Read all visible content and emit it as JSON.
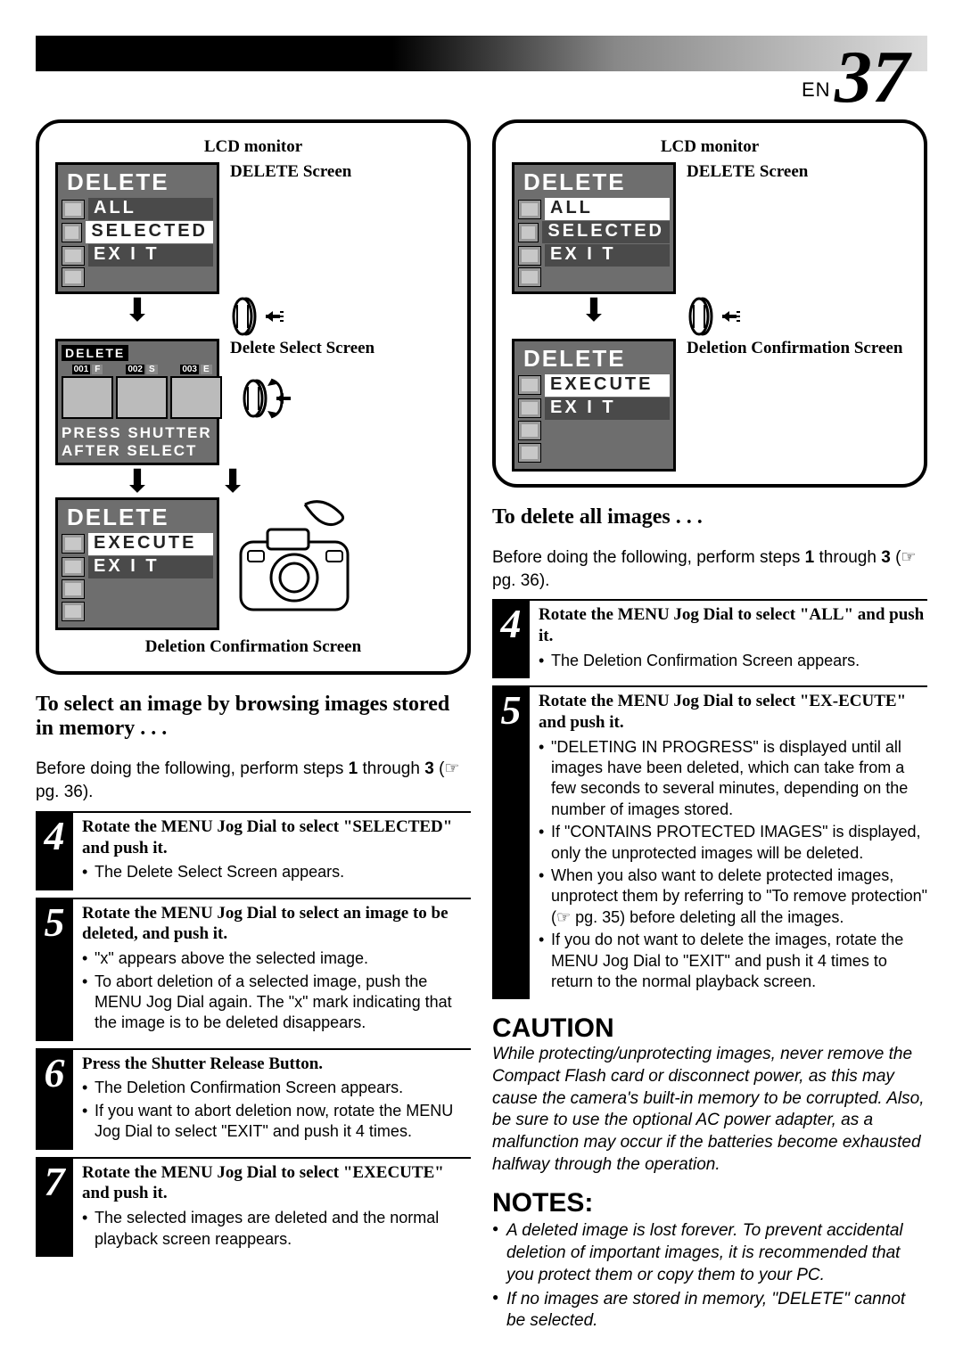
{
  "page": {
    "lang_prefix": "EN",
    "number": "37"
  },
  "labels": {
    "lcd_monitor": "LCD monitor",
    "delete_screen": "DELETE Screen",
    "delete_select_screen": "Delete Select Screen",
    "deletion_confirmation_screen": "Deletion Confirmation Screen",
    "select_footer_line1": "PRESS  SHUTTER",
    "select_footer_line2": "AFTER  SELECT"
  },
  "lcd_menu": {
    "title": "DELETE",
    "items": [
      "ALL",
      "SELECTED",
      "EX I T"
    ]
  },
  "lcd_confirm": {
    "title": "DELETE",
    "items": [
      "EXECUTE",
      "EX I T"
    ]
  },
  "lcd_select": {
    "title": "DELETE",
    "thumbs": [
      {
        "num": "001",
        "let": "F"
      },
      {
        "num": "002",
        "let": "S"
      },
      {
        "num": "003",
        "let": "E"
      }
    ]
  },
  "left": {
    "heading": "To select an image by browsing images stored in memory . . .",
    "intro_a": "Before doing the following, perform steps ",
    "intro_b": " through ",
    "step1": "1",
    "step3": "3",
    "pgref": "pg. 36).",
    "steps": [
      {
        "n": "4",
        "title": "Rotate the MENU Jog Dial to select \"SELECTED\" and push it.",
        "bullets": [
          "The Delete Select Screen appears."
        ]
      },
      {
        "n": "5",
        "title": "Rotate the MENU Jog Dial to select an image to be deleted, and push it.",
        "bullets": [
          "\"x\" appears above the selected image.",
          "To abort deletion of a selected image, push the MENU Jog Dial again. The \"x\" mark indicating that the image is to be deleted disappears."
        ]
      },
      {
        "n": "6",
        "title": "Press the Shutter Release Button.",
        "bullets": [
          "The Deletion Confirmation Screen appears.",
          "If you want to abort deletion now, rotate the MENU Jog Dial to select \"EXIT\" and push it 4 times."
        ]
      },
      {
        "n": "7",
        "title": "Rotate the MENU Jog Dial to select \"EXECUTE\" and push it.",
        "bullets": [
          "The selected images are deleted and the normal playback screen reappears."
        ]
      }
    ]
  },
  "right": {
    "heading": "To delete all images . . .",
    "intro_a": "Before doing the following, perform steps ",
    "intro_b": " through ",
    "step1": "1",
    "step3": "3",
    "pgref": "pg. 36).",
    "steps": [
      {
        "n": "4",
        "title": "Rotate the MENU Jog Dial to select \"ALL\" and push it.",
        "bullets": [
          "The Deletion Confirmation Screen appears."
        ]
      },
      {
        "n": "5",
        "title": "Rotate the MENU Jog Dial to select \"EX-ECUTE\" and push it.",
        "bullets": [
          "\"DELETING IN PROGRESS\" is displayed until all images have been deleted, which can take from a few seconds to several minutes, depending on the number of images stored.",
          "If \"CONTAINS PROTECTED IMAGES\" is displayed, only the unprotected images will be deleted.",
          "When you also want to delete protected images, unprotect them by referring to \"To remove protection\" (☞ pg. 35) before deleting all the images.",
          "If you do not want to delete the images, rotate the MENU Jog Dial to \"EXIT\" and push it 4 times to return to the normal playback screen."
        ]
      }
    ],
    "caution_h": "CAUTION",
    "caution_body": "While protecting/unprotecting images, never remove the Compact Flash card or disconnect power, as this may cause the camera's built-in memory to be corrupted. Also, be sure to use the optional AC power adapter, as a malfunction may occur if the batteries become exhausted halfway through the operation.",
    "notes_h": "NOTES:",
    "notes": [
      "A deleted image is lost forever. To prevent accidental deletion of important images, it is recommended that you protect them or copy them to your PC.",
      "If no images are stored in memory, \"DELETE\" cannot be selected."
    ]
  }
}
